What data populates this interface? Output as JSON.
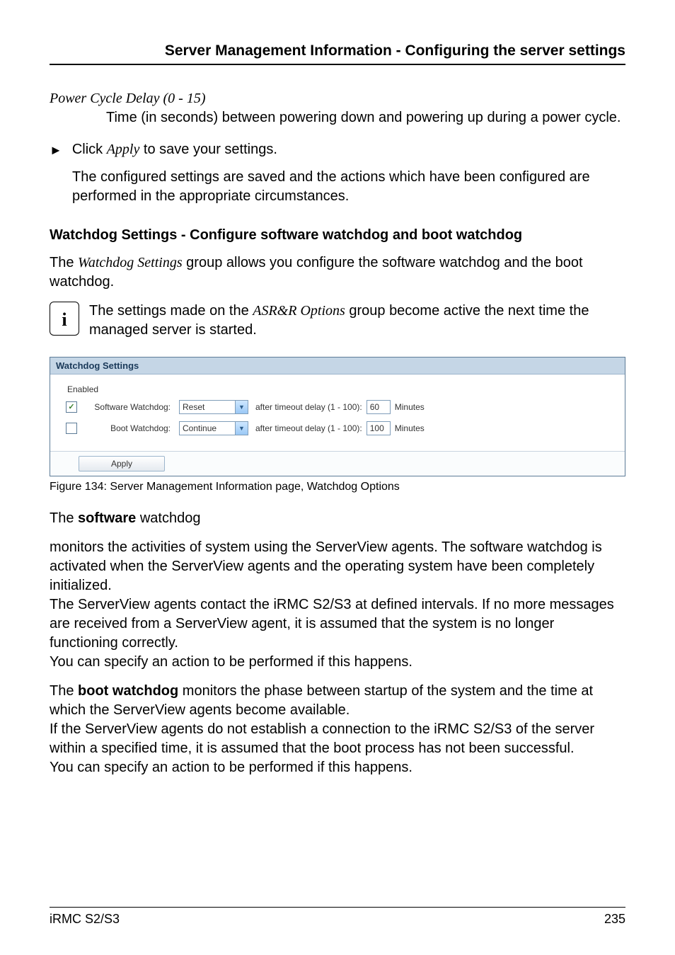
{
  "header": {
    "title": "Server Management Information - Configuring the server settings"
  },
  "power_cycle": {
    "heading": "Power Cycle Delay (0 - 15)",
    "body": "Time (in seconds) between powering down and powering up during a power cycle."
  },
  "apply_step": {
    "prefix": "Click ",
    "apply_word": "Apply",
    "suffix": " to save your settings."
  },
  "apply_result": "The configured settings are saved and the actions which have been configured are performed in the appropriate circumstances.",
  "watchdog_heading": "Watchdog Settings - Configure software watchdog and boot watchdog",
  "watchdog_intro": {
    "prefix": "The ",
    "italic": "Watchdog Settings",
    "suffix": " group allows you configure the software watchdog and the boot watchdog."
  },
  "note": {
    "prefix": "The settings made on the ",
    "italic": "ASR&R Options",
    "suffix": " group become active the next time the managed server is started."
  },
  "panel": {
    "title": "Watchdog Settings",
    "enabled_label": "Enabled",
    "rows": [
      {
        "checked": true,
        "label": "Software Watchdog:",
        "action": "Reset",
        "after_text": "after timeout delay (1 - 100):",
        "value": "60",
        "unit": "Minutes"
      },
      {
        "checked": false,
        "label": "Boot Watchdog:",
        "action": "Continue",
        "after_text": "after timeout delay (1 - 100):",
        "value": "100",
        "unit": "Minutes"
      }
    ],
    "apply_label": "Apply"
  },
  "figure_caption": "Figure 134: Server Management Information page, Watchdog Options",
  "software_heading": {
    "prefix": "The ",
    "bold": "software",
    "suffix": " watchdog"
  },
  "software_para1": " monitors the activities of system using the ServerView agents. The software watchdog is activated when the ServerView agents and the operating system have been completely initialized.",
  "software_para2": "The ServerView agents contact the iRMC S2/S3 at defined intervals. If no more messages are received from a ServerView agent, it is assumed that the system is no longer functioning correctly.",
  "software_para3": "You can specify an action to be performed if this happens.",
  "boot_heading": {
    "prefix": "The ",
    "bold": "boot watchdog",
    "suffix": " monitors the phase between startup of the system and the time at which the ServerView agents become available."
  },
  "boot_para2": "If the ServerView agents do not establish a connection to the iRMC S2/S3 of the server within a specified time, it is assumed that the boot process has not been successful.",
  "boot_para3": "You can specify an action to be performed if this happens.",
  "footer": {
    "left": "iRMC S2/S3",
    "right": "235"
  }
}
